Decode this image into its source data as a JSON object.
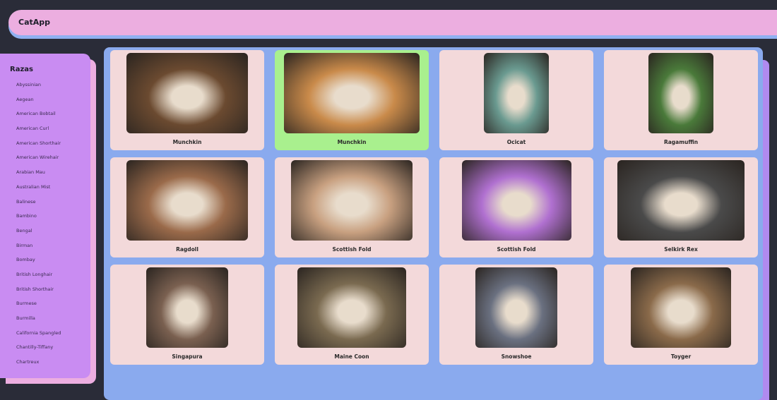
{
  "header": {
    "title": "CatApp"
  },
  "sidebar": {
    "title": "Razas",
    "items": [
      "Abyssinian",
      "Aegean",
      "American Bobtail",
      "American Curl",
      "American Shorthair",
      "American Wirehair",
      "Arabian Mau",
      "Australian Mist",
      "Balinese",
      "Bambino",
      "Bengal",
      "Birman",
      "Bombay",
      "British Longhair",
      "British Shorthair",
      "Burmese",
      "Burmilla",
      "California Spangled",
      "Chantilly-Tiffany",
      "Chartreux"
    ]
  },
  "cards": [
    {
      "name": "Munchkin",
      "selected": false,
      "color": "#6b4a30"
    },
    {
      "name": "Munchkin",
      "selected": true,
      "color": "#c98a4a"
    },
    {
      "name": "Ocicat",
      "selected": false,
      "color": "#6a9a90"
    },
    {
      "name": "Ragamuffin",
      "selected": false,
      "color": "#4a7a3a"
    },
    {
      "name": "Ragdoll",
      "selected": false,
      "color": "#9a6a4a"
    },
    {
      "name": "Scottish Fold",
      "selected": false,
      "color": "#c8a080"
    },
    {
      "name": "Scottish Fold",
      "selected": false,
      "color": "#b070d0"
    },
    {
      "name": "Selkirk Rex",
      "selected": false,
      "color": "#4a4a4a"
    },
    {
      "name": "Singapura",
      "selected": false,
      "color": "#7a6050"
    },
    {
      "name": "Maine Coon",
      "selected": false,
      "color": "#7a6a50"
    },
    {
      "name": "Snowshoe",
      "selected": false,
      "color": "#6a7080"
    },
    {
      "name": "Toyger",
      "selected": false,
      "color": "#8a6a4a"
    }
  ]
}
